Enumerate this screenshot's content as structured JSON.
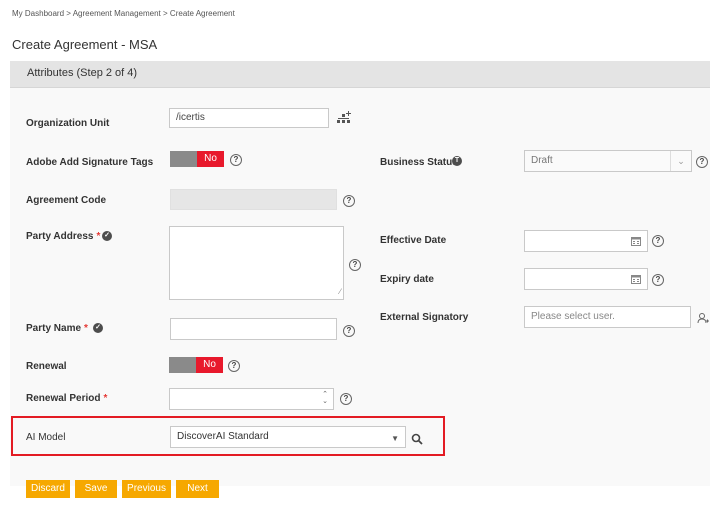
{
  "breadcrumb": {
    "items": [
      "My Dashboard",
      "Agreement Management",
      "Create Agreement"
    ],
    "separator": ">"
  },
  "page_title": "Create Agreement - MSA",
  "section": {
    "title": "Attributes (Step 2 of 4)"
  },
  "fields": {
    "organization_unit": {
      "label": "Organization Unit",
      "value": "/icertis",
      "icon": "hierarchy-icon"
    },
    "adobe_signature_tags": {
      "label": "Adobe Add Signature Tags",
      "toggle": "No"
    },
    "business_status": {
      "label": "Business Status",
      "value": "Draft"
    },
    "agreement_code": {
      "label": "Agreement Code"
    },
    "party_address": {
      "label": "Party Address",
      "required": "*"
    },
    "effective_date": {
      "label": "Effective Date"
    },
    "expiry_date": {
      "label": "Expiry date"
    },
    "external_signatory": {
      "label": "External Signatory",
      "placeholder": "Please select user."
    },
    "party_name": {
      "label": "Party Name",
      "required": "*"
    },
    "renewal": {
      "label": "Renewal",
      "toggle": "No"
    },
    "renewal_period": {
      "label": "Renewal Period",
      "required": "*"
    },
    "ai_model": {
      "label": "AI Model",
      "value": "DiscoverAI Standard"
    }
  },
  "help_glyph": "?",
  "buttons": {
    "discard": "Discard",
    "save": "Save",
    "previous": "Previous",
    "next": "Next"
  },
  "colors": {
    "button": "#f6a800",
    "toggle_on": "#e8192c",
    "highlight": "#e31b23",
    "toggle_off": "#8a8a8a"
  }
}
